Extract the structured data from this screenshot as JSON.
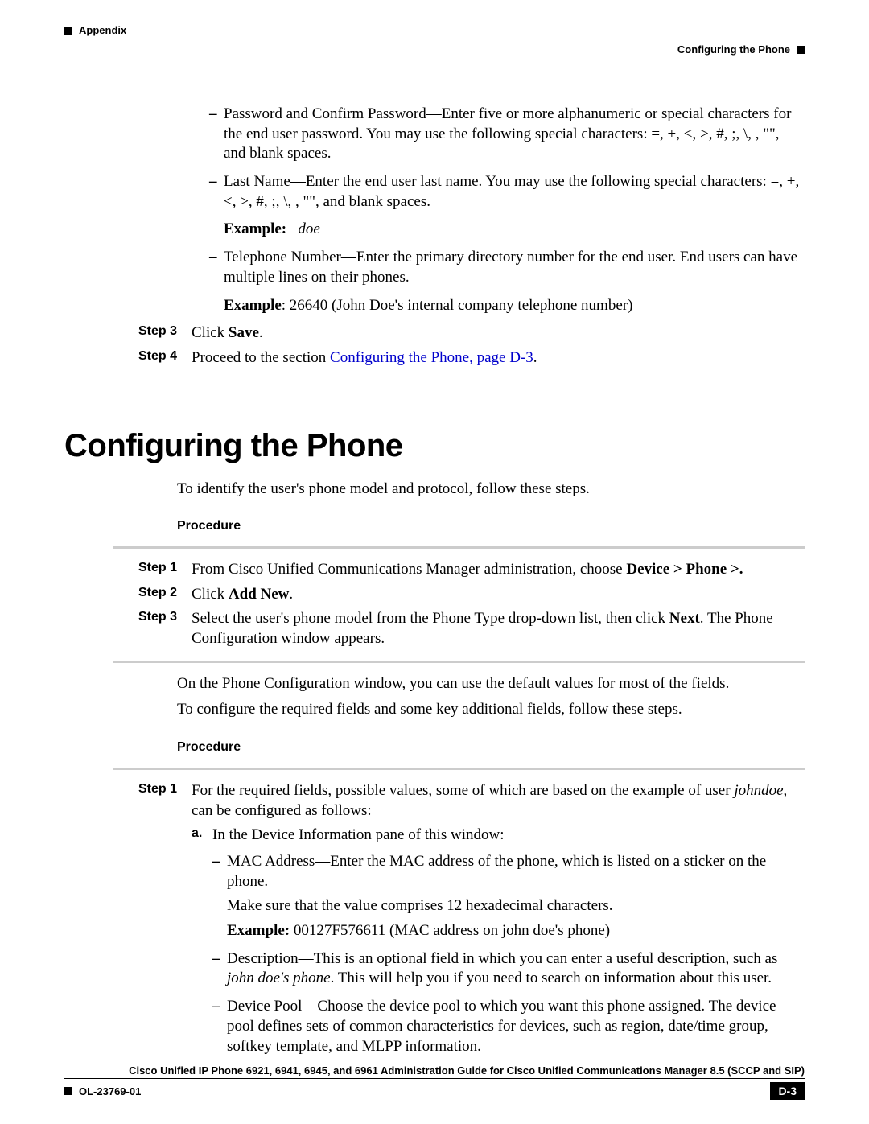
{
  "header": {
    "left": "Appendix",
    "right": "Configuring the Phone"
  },
  "top_bullets": {
    "password": "Password and Confirm Password—Enter five or more alphanumeric or special characters for the end user password. You may use the following special characters: =, +, <, >, #, ;, \\, , \"\", and blank spaces.",
    "lastname": "Last Name—Enter the end user last name. You may use the following special characters: =, +, <, >, #, ;, \\, , \"\", and blank spaces.",
    "lastname_example_label": "Example:",
    "lastname_example_value": "doe",
    "telephone": "Telephone Number—Enter the primary directory number for the end user. End users can have multiple lines on their phones.",
    "telephone_example_label": "Example",
    "telephone_example_value": ": 26640 (John Doe's internal company telephone number)"
  },
  "top_steps": {
    "s3_label": "Step 3",
    "s3_text_a": "Click ",
    "s3_text_b": "Save",
    "s3_text_c": ".",
    "s4_label": "Step 4",
    "s4_text_a": "Proceed to the section ",
    "s4_link": "Configuring the Phone, page D-3",
    "s4_text_b": "."
  },
  "section": {
    "title": "Configuring the Phone",
    "intro": "To identify the user's phone model and protocol, follow these steps.",
    "procedure_label": "Procedure",
    "p1": {
      "s1_label": "Step 1",
      "s1_a": "From Cisco Unified Communications Manager administration, choose ",
      "s1_b": "Device > Phone >.",
      "s2_label": "Step 2",
      "s2_a": "Click ",
      "s2_b": "Add New",
      "s2_c": ".",
      "s3_label": "Step 3",
      "s3_a": "Select the user's phone model from the Phone Type drop-down list, then click ",
      "s3_b": "Next",
      "s3_c": ". The Phone Configuration window appears."
    },
    "mid1": "On the Phone Configuration window, you can use the default values for most of the fields.",
    "mid2": "To configure the required fields and some key additional fields, follow these steps.",
    "p2": {
      "s1_label": "Step 1",
      "s1_a": "For the required fields, possible values, some of which are based on the example of user ",
      "s1_b": "johndoe",
      "s1_c": ", can be configured as follows:",
      "a_label": "a.",
      "a_text": "In the Device Information pane of this window:",
      "mac1": "MAC Address—Enter the MAC address of the phone, which is listed on a sticker on the phone.",
      "mac2": "Make sure that the value comprises 12 hexadecimal characters.",
      "mac_ex_label": "Example:",
      "mac_ex_value": " 00127F576611 (MAC address on john doe's phone)",
      "desc_a": "Description—This is an optional field in which you can enter a useful description, such as ",
      "desc_b": "john doe's phone",
      "desc_c": ". This will help you if you need to search on information about this user.",
      "pool": "Device Pool—Choose the device pool to which you want this phone assigned. The device pool defines sets of common characteristics for devices, such as region, date/time group, softkey template, and MLPP information."
    }
  },
  "footer": {
    "title": "Cisco Unified IP Phone 6921, 6941, 6945, and 6961 Administration Guide for Cisco Unified Communications Manager 8.5 (SCCP and SIP)",
    "doc_id": "OL-23769-01",
    "page_num": "D-3"
  }
}
